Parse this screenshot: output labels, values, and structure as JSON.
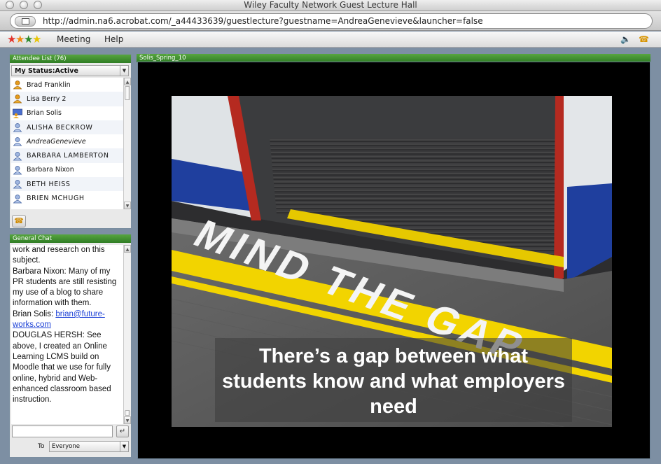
{
  "window": {
    "title": "Wiley Faculty Network Guest Lecture Hall"
  },
  "browser": {
    "url": "http://admin.na6.acrobat.com/_a44433639/guestlecture?guestname=AndreaGenevieve&launcher=false"
  },
  "menu": {
    "items": [
      "Meeting",
      "Help"
    ]
  },
  "attendees": {
    "header": "Attendee List (76)",
    "status_label": "My Status:Active",
    "items": [
      {
        "name": "Brad Franklin",
        "role": "host",
        "style": "normal"
      },
      {
        "name": "Lisa Berry 2",
        "role": "host",
        "style": "normal"
      },
      {
        "name": "Brian Solis",
        "role": "presenter",
        "style": "normal"
      },
      {
        "name": "ALISHA BECKROW",
        "role": "participant",
        "style": "normal"
      },
      {
        "name": "AndreaGenevieve",
        "role": "participant",
        "style": "italic"
      },
      {
        "name": "BARBARA LAMBERTON",
        "role": "participant",
        "style": "normal"
      },
      {
        "name": "Barbara Nixon",
        "role": "participant",
        "style": "normal"
      },
      {
        "name": "BETH HEISS",
        "role": "participant",
        "style": "normal"
      },
      {
        "name": "BRIEN MCHUGH",
        "role": "participant",
        "style": "normal"
      }
    ]
  },
  "chat": {
    "header": "General Chat",
    "line1": "work and research on this subject.",
    "line2": "Barbara Nixon: Many of my PR students are still resisting my use of a blog to share information with them.",
    "line3_prefix": "Brian Solis: ",
    "line3_link": "brian@future-works.com",
    "line4": "DOUGLAS HERSH: See above, I created an Online Learning LCMS build on Moodle that we use for fully online, hybrid and Web-enhanced classroom based instruction.",
    "to_label": "To",
    "to_value": "Everyone"
  },
  "share": {
    "header": "Solis_Spring_10",
    "slide_floor_text": "MIND THE GAP",
    "slide_caption": "There’s  a gap between what students know and what employers need"
  },
  "colors": {
    "panel_header": "#3f902f",
    "link": "#1a3fd6",
    "yellow_line": "#f2d400",
    "train_blue": "#1f3f9e",
    "train_red": "#b52a20"
  },
  "icons": {
    "host": "host-user-icon",
    "presenter": "presenter-user-icon",
    "participant": "participant-user-icon",
    "phone": "telephone-icon",
    "speaker": "speaker-icon"
  }
}
